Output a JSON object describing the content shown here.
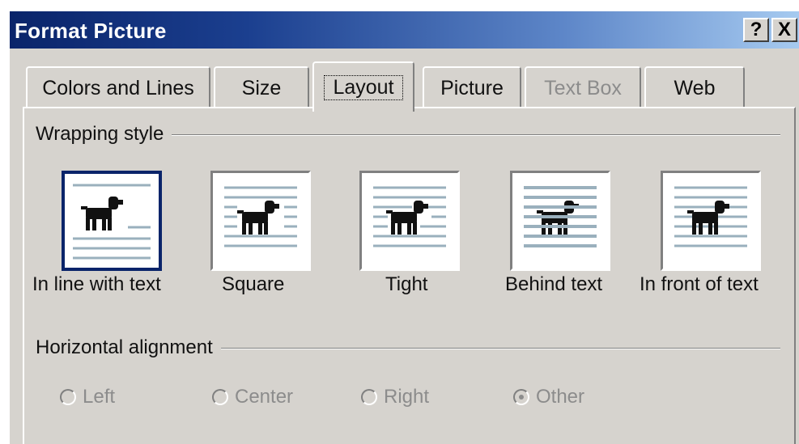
{
  "dialog": {
    "title": "Format Picture",
    "help_label": "?",
    "close_label": "X"
  },
  "tabs": [
    {
      "label": "Colors and Lines",
      "state": "normal"
    },
    {
      "label": "Size",
      "state": "normal"
    },
    {
      "label": "Layout",
      "state": "active"
    },
    {
      "label": "Picture",
      "state": "normal"
    },
    {
      "label": "Text Box",
      "state": "disabled"
    },
    {
      "label": "Web",
      "state": "normal"
    }
  ],
  "wrapping": {
    "label": "Wrapping style",
    "options": [
      {
        "label": "In line with text",
        "selected": true,
        "icon": "wrap-inline-icon"
      },
      {
        "label": "Square",
        "selected": false,
        "icon": "wrap-square-icon"
      },
      {
        "label": "Tight",
        "selected": false,
        "icon": "wrap-tight-icon"
      },
      {
        "label": "Behind text",
        "selected": false,
        "icon": "wrap-behind-icon"
      },
      {
        "label": "In front of text",
        "selected": false,
        "icon": "wrap-front-icon"
      }
    ]
  },
  "alignment": {
    "label": "Horizontal alignment",
    "options": [
      {
        "label": "Left",
        "checked": false
      },
      {
        "label": "Center",
        "checked": false
      },
      {
        "label": "Right",
        "checked": false
      },
      {
        "label": "Other",
        "checked": true
      }
    ]
  },
  "colors": {
    "title_bar_start": "#0a246a",
    "title_bar_end": "#a6caf0",
    "face": "#d6d3ce",
    "disabled_text": "#8c8c8c",
    "selection": "#0a246a",
    "text_lines": "#9ab0bd"
  }
}
